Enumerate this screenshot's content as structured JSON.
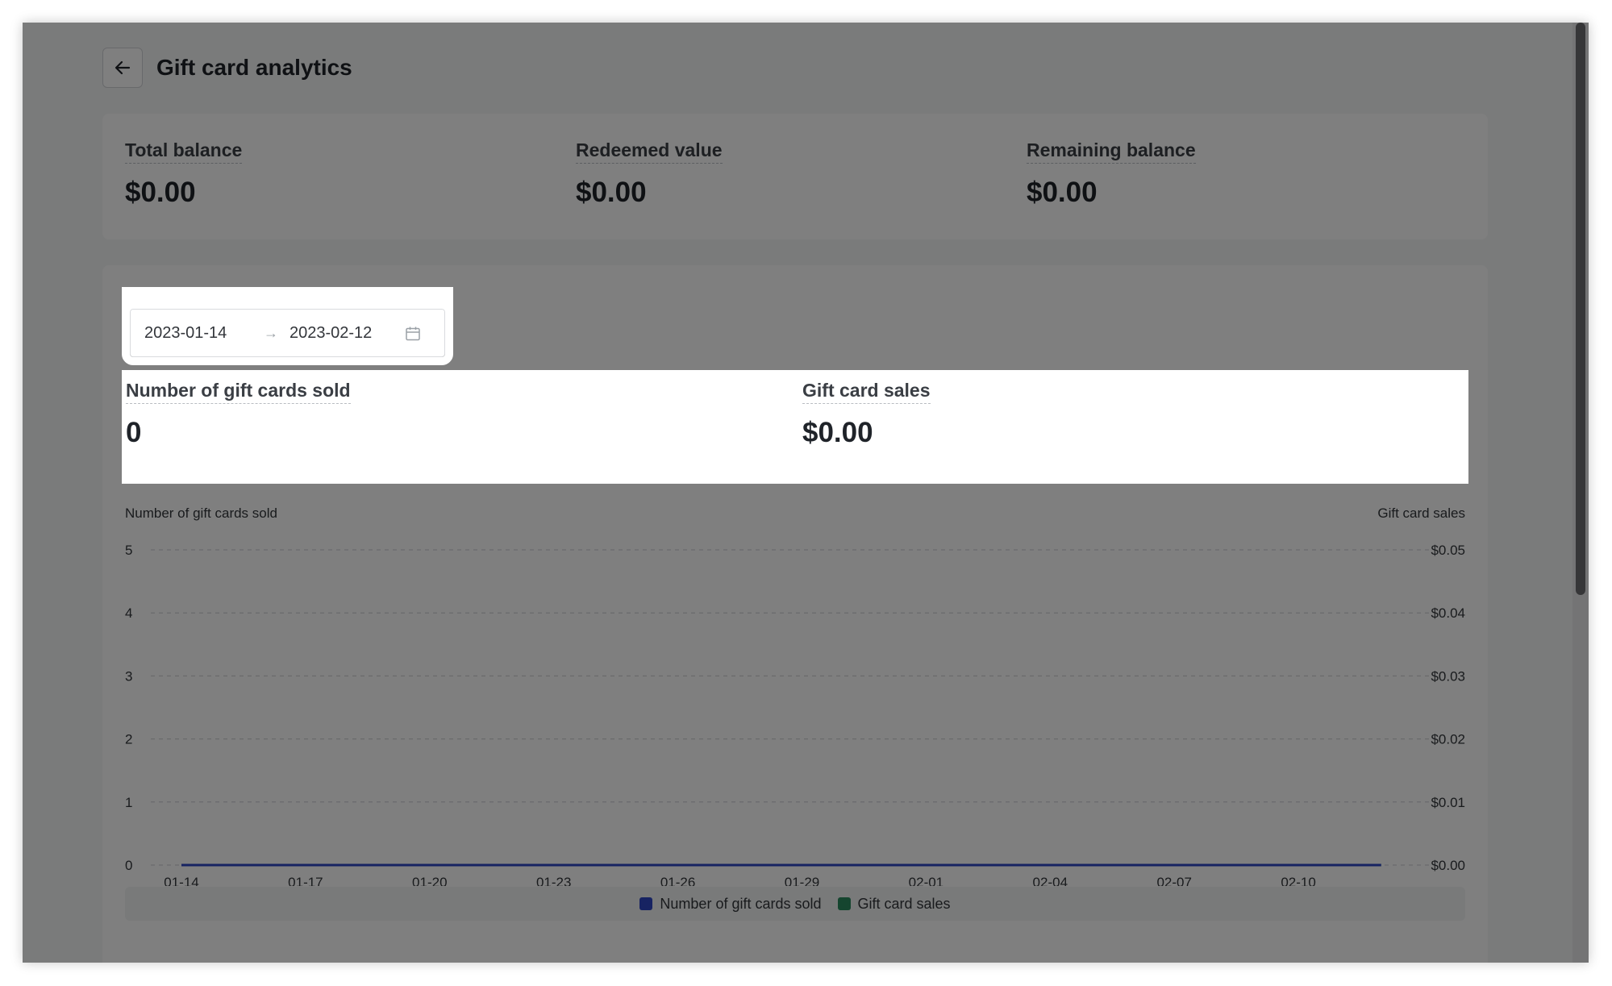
{
  "header": {
    "title": "Gift card analytics"
  },
  "summary": [
    {
      "label": "Total balance",
      "value": "$0.00"
    },
    {
      "label": "Redeemed value",
      "value": "$0.00"
    },
    {
      "label": "Remaining balance",
      "value": "$0.00"
    }
  ],
  "date_range": {
    "start": "2023-01-14",
    "separator": "→",
    "end": "2023-02-12"
  },
  "stats": [
    {
      "label": "Number of gift cards sold",
      "value": "0"
    },
    {
      "label": "Gift card sales",
      "value": "$0.00"
    }
  ],
  "colors": {
    "series_count": "#2f47c4",
    "series_sales": "#2a8a5f",
    "grid": "#c9ccd0",
    "text": "#33363b"
  },
  "icons": {
    "back": "arrow-left-icon",
    "calendar": "calendar-icon"
  },
  "chart_data": {
    "type": "line",
    "x": [
      "01-14",
      "01-15",
      "01-16",
      "01-17",
      "01-18",
      "01-19",
      "01-20",
      "01-21",
      "01-22",
      "01-23",
      "01-24",
      "01-25",
      "01-26",
      "01-27",
      "01-28",
      "01-29",
      "01-30",
      "01-31",
      "02-01",
      "02-02",
      "02-03",
      "02-04",
      "02-05",
      "02-06",
      "02-07",
      "02-08",
      "02-09",
      "02-10",
      "02-11",
      "02-12"
    ],
    "x_tick_labels": [
      "01-14",
      "01-17",
      "01-20",
      "01-23",
      "01-26",
      "01-29",
      "02-01",
      "02-04",
      "02-07",
      "02-10"
    ],
    "ylabel": "Number of gift cards sold",
    "ylabel_right": "Gift card sales",
    "ylim": [
      0,
      5
    ],
    "y_ticks": [
      "0",
      "1",
      "2",
      "3",
      "4",
      "5"
    ],
    "ylim_right": [
      0,
      0.05
    ],
    "y_ticks_right": [
      "$0.00",
      "$0.01",
      "$0.02",
      "$0.03",
      "$0.04",
      "$0.05"
    ],
    "grid": true,
    "legend_placement": "bottom",
    "series": [
      {
        "name": "Number of gift cards sold",
        "axis": "left",
        "values": [
          0,
          0,
          0,
          0,
          0,
          0,
          0,
          0,
          0,
          0,
          0,
          0,
          0,
          0,
          0,
          0,
          0,
          0,
          0,
          0,
          0,
          0,
          0,
          0,
          0,
          0,
          0,
          0,
          0,
          0
        ]
      },
      {
        "name": "Gift card sales",
        "axis": "right",
        "values": [
          0,
          0,
          0,
          0,
          0,
          0,
          0,
          0,
          0,
          0,
          0,
          0,
          0,
          0,
          0,
          0,
          0,
          0,
          0,
          0,
          0,
          0,
          0,
          0,
          0,
          0,
          0,
          0,
          0,
          0
        ]
      }
    ]
  }
}
